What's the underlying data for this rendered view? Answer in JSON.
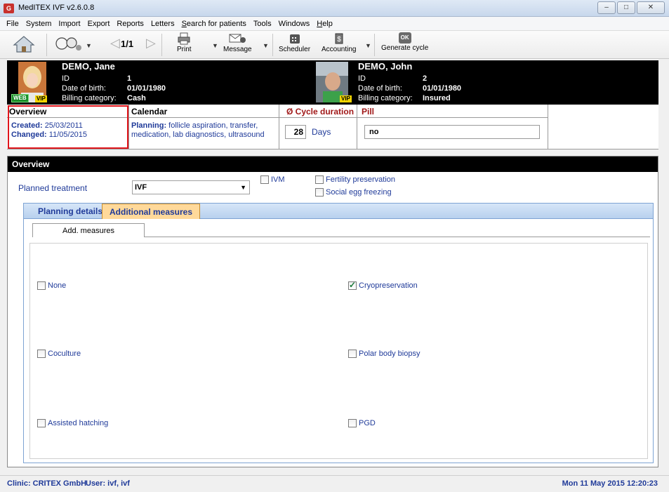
{
  "window": {
    "title": "MedITEX IVF v2.6.0.8",
    "app_icon": "G"
  },
  "menu": [
    {
      "label": "File"
    },
    {
      "label": "System"
    },
    {
      "label": "Import"
    },
    {
      "label": "Export"
    },
    {
      "label": "Reports"
    },
    {
      "label": "Letters"
    },
    {
      "label": "Search for patients"
    },
    {
      "label": "Tools"
    },
    {
      "label": "Windows"
    },
    {
      "label": "Help"
    }
  ],
  "toolbar": {
    "nav_position": "1/1",
    "print_label": "Print",
    "message_label": "Message",
    "scheduler_label": "Scheduler",
    "accounting_label": "Accounting",
    "generate_label": "Generate cycle",
    "generate_icon_text": "OK"
  },
  "patient_female": {
    "name": "DEMO, Jane",
    "id_label": "ID",
    "id": "1",
    "dob_label": "Date of birth:",
    "dob": "01/01/1980",
    "billing_label": "Billing category:",
    "billing": "Cash",
    "badges": [
      "WEB",
      "VIP"
    ]
  },
  "patient_male": {
    "name": "DEMO, John",
    "id_label": "ID",
    "id": "2",
    "dob_label": "Date of birth:",
    "dob": "01/01/1980",
    "billing_label": "Billing category:",
    "billing": "Insured",
    "badges": [
      "VIP"
    ]
  },
  "info": {
    "overview_title": "Overview",
    "created_label": "Created:",
    "created": "25/03/2011",
    "changed_label": "Changed:",
    "changed": "11/05/2015",
    "calendar_title": "Calendar",
    "planning_label": "Planning:",
    "planning_line1": "follicle aspiration, transfer,",
    "planning_line2": "medication, lab diagnostics, ultrasound",
    "cycle_title": "Ø Cycle duration",
    "cycle_days": "28",
    "cycle_unit": "Days",
    "pill_title": "Pill",
    "pill_value": "no"
  },
  "overview": {
    "title": "Overview",
    "planned_treatment_label": "Planned treatment",
    "planned_treatment_value": "IVF",
    "ivm_label": "IVM",
    "ivm_checked": false,
    "fertility_label": "Fertility preservation",
    "fertility_checked": false,
    "social_label": "Social egg freezing",
    "social_checked": false,
    "tabs": [
      {
        "label": "Planning details"
      },
      {
        "label": "Additional measures"
      }
    ],
    "subtab": "Add. measures",
    "measures": [
      {
        "label": "None",
        "checked": false
      },
      {
        "label": "Cryopreservation",
        "checked": true
      },
      {
        "label": "Coculture",
        "checked": false
      },
      {
        "label": "Polar body biopsy",
        "checked": false
      },
      {
        "label": "Assisted hatching",
        "checked": false
      },
      {
        "label": "PGD",
        "checked": false
      }
    ]
  },
  "status": {
    "clinic": "Clinic: CRITEX GmbH",
    "user": "User: ivf, ivf",
    "datetime": "Mon 11 May 2015 12:20:23"
  }
}
